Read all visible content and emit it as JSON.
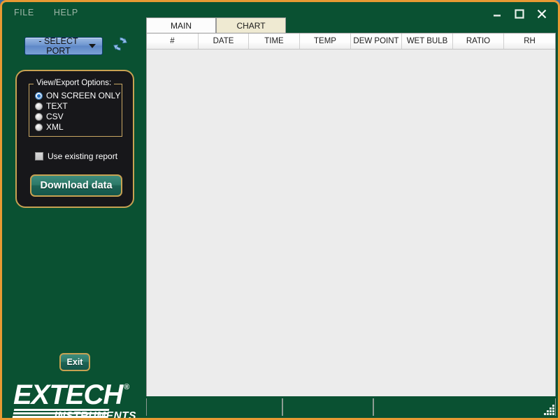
{
  "window": {
    "border_color": "#e89a33",
    "background_color": "#0a5132",
    "controls": {
      "minimize": "minimize-icon",
      "maximize": "maximize-icon",
      "close": "close-icon"
    }
  },
  "menu": {
    "items": [
      {
        "label": "FILE"
      },
      {
        "label": "HELP"
      }
    ]
  },
  "port": {
    "selected": "- SELECT PORT",
    "caret": "chevron-down-icon",
    "refresh": "refresh-icon"
  },
  "options": {
    "legend": "View/Export Options:",
    "radios": [
      {
        "label": "ON SCREEN ONLY",
        "checked": true
      },
      {
        "label": "TEXT",
        "checked": false
      },
      {
        "label": "CSV",
        "checked": false
      },
      {
        "label": "XML",
        "checked": false
      }
    ],
    "checkbox": {
      "label": "Use existing report",
      "checked": false
    },
    "download_label": "Download data",
    "accent_color": "#c8a252",
    "button_color": "#1d6355"
  },
  "exit": {
    "label": "Exit"
  },
  "logo": {
    "wordmark": "EXTECH",
    "registered": "®",
    "subtitle": "INSTRUMENTS"
  },
  "tabs": [
    {
      "label": "MAIN",
      "active": true
    },
    {
      "label": "CHART",
      "active": false
    }
  ],
  "table": {
    "columns": [
      {
        "label": "#",
        "width": 74
      },
      {
        "label": "DATE",
        "width": 72
      },
      {
        "label": "TIME",
        "width": 73
      },
      {
        "label": "TEMP",
        "width": 73
      },
      {
        "label": "DEW POINT",
        "width": 73
      },
      {
        "label": "WET BULB",
        "width": 73
      },
      {
        "label": "RATIO",
        "width": 73
      },
      {
        "label": "RH",
        "width": 73
      }
    ],
    "rows": []
  },
  "status_bar": {
    "cells": [
      "",
      "",
      ""
    ]
  }
}
